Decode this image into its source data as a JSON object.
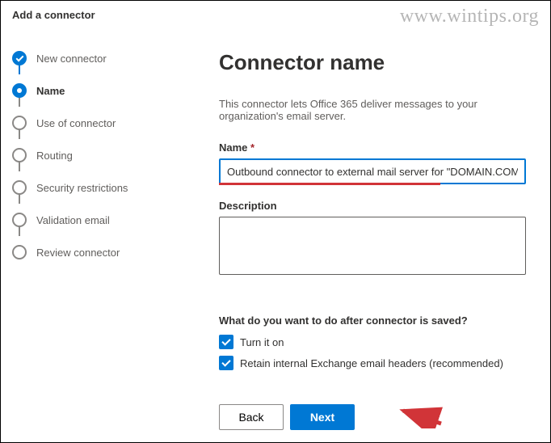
{
  "header": {
    "title": "Add a connector"
  },
  "watermark": "www.wintips.org",
  "sidebar": {
    "steps": [
      {
        "label": "New connector"
      },
      {
        "label": "Name"
      },
      {
        "label": "Use of connector"
      },
      {
        "label": "Routing"
      },
      {
        "label": "Security restrictions"
      },
      {
        "label": "Validation email"
      },
      {
        "label": "Review connector"
      }
    ]
  },
  "main": {
    "title": "Connector name",
    "intro": "This connector lets Office 365 deliver messages to your organization's email server.",
    "name_label": "Name",
    "name_value": "Outbound connector to external mail server for \"DOMAIN.COM\"",
    "desc_label": "Description",
    "desc_value": "",
    "after_save_question": "What do you want to do after connector is saved?",
    "checkbox1_label": "Turn it on",
    "checkbox2_label": "Retain internal Exchange email headers (recommended)"
  },
  "footer": {
    "back_label": "Back",
    "next_label": "Next"
  }
}
